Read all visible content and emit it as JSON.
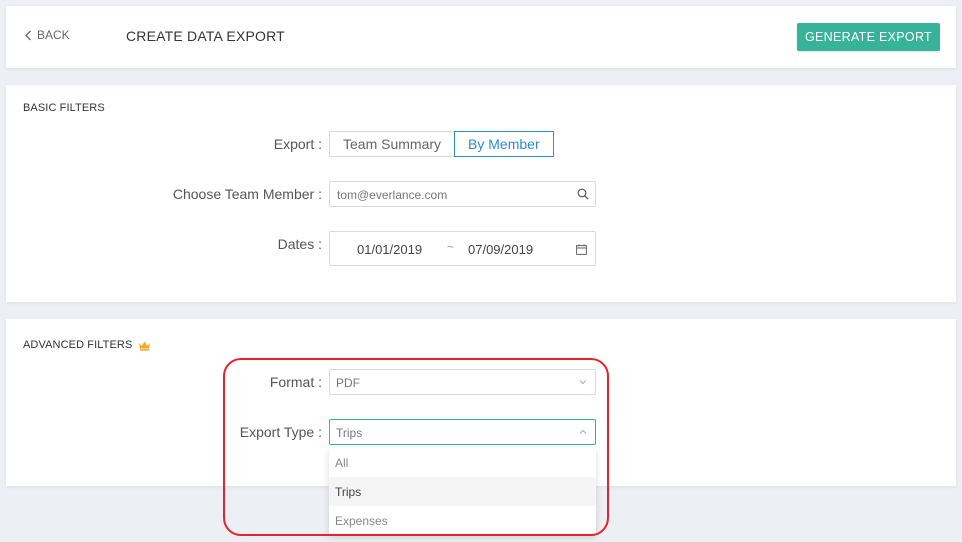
{
  "header": {
    "back_label": "BACK",
    "title": "CREATE DATA EXPORT",
    "generate_label": "GENERATE EXPORT"
  },
  "basic_filters": {
    "title": "BASIC FILTERS",
    "export_label": "Export",
    "export_options": [
      "Team Summary",
      "By Member"
    ],
    "export_selected": "By Member",
    "member_label": "Choose Team Member",
    "member_value": "tom@everlance.com",
    "dates_label": "Dates",
    "date_start": "01/01/2019",
    "date_separator": "~",
    "date_end": "07/09/2019"
  },
  "advanced_filters": {
    "title": "ADVANCED FILTERS",
    "format_label": "Format",
    "format_value": "PDF",
    "export_type_label": "Export Type",
    "export_type_value": "Trips",
    "export_type_options": [
      "All",
      "Trips",
      "Expenses"
    ]
  },
  "colors": {
    "accent": "#37b39a",
    "link_blue": "#2e8bd1",
    "crown": "#f5a623",
    "highlight": "#e8212c"
  }
}
